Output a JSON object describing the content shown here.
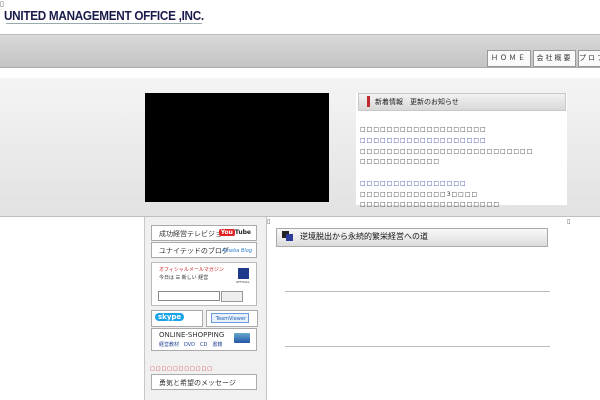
{
  "header": {
    "logo_text": "UNITED  MANAGEMENT OFFICE ,INC.",
    "corner_mark": "▯"
  },
  "nav": {
    "items": [
      {
        "label": "ＨＯＭＥ"
      },
      {
        "label": "会社概要"
      },
      {
        "label": "プロフィ"
      }
    ]
  },
  "news": {
    "title": "新着情報　更新のお知らせ",
    "lines": [
      {
        "text": "□□□□□□□□□□□□□□□□□□□",
        "link": false
      },
      {
        "text": "□□□□□□□□□□□□□□□□□□□",
        "link": true
      },
      {
        "text": "□□□□□□□□□□□□□□□□□□□□□□□□□□",
        "link": false
      },
      {
        "text": "□□□□□□□□□□□□",
        "link": false
      },
      {
        "text": "□□□□□□□□□□□□□□□□",
        "link": true
      },
      {
        "text": "□□□□□□□□□□□□□3□□□□",
        "link": false
      },
      {
        "text": "□□□□□□□□□□□□□□□□□□□□□",
        "link": false
      }
    ]
  },
  "sidebar": {
    "tv_label": "成功経営テレビジョン",
    "tv_badge_you": "You",
    "tv_badge_tube": "Tube",
    "blog_label": "ユナイテッドのブログ",
    "blog_mark": "Ameba Blog",
    "mag_title": "オフィシャルメールマガジン",
    "mag_sub": "今日は ☰ 新しい 経営",
    "mag_badge": "OFFICIAL",
    "skype_label": "skype",
    "teamviewer_label": "TeamViewer",
    "shop_label": "ONLINE-SHOPPING",
    "shop_sub": "経営教材　DVD　CD　書籍",
    "red_text": "□□□□□□□□□□□",
    "message_label": "勇気と希望のメッセージ"
  },
  "content": {
    "title": "逆境脱出から永続的繁栄経営への道"
  },
  "marks": {
    "small_square": "▯"
  },
  "colors": {
    "accent_red": "#c0282f",
    "link_blue": "#2b3b9b"
  }
}
